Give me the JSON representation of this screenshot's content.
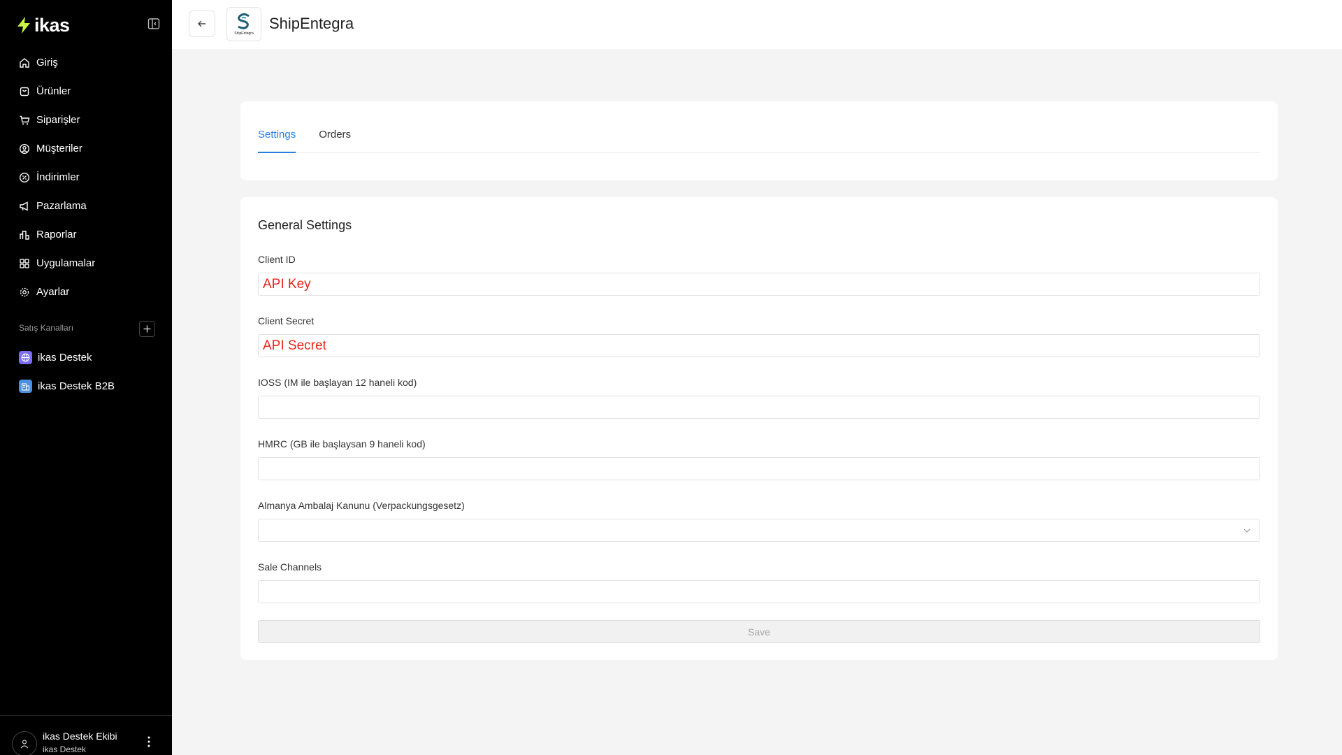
{
  "sidebar": {
    "logo_text": "ikas",
    "nav": [
      {
        "label": "Giriş",
        "icon": "home-icon"
      },
      {
        "label": "Ürünler",
        "icon": "box-icon"
      },
      {
        "label": "Siparişler",
        "icon": "cart-icon"
      },
      {
        "label": "Müşteriler",
        "icon": "user-circle-icon"
      },
      {
        "label": "İndirimler",
        "icon": "discount-icon"
      },
      {
        "label": "Pazarlama",
        "icon": "megaphone-icon"
      },
      {
        "label": "Raporlar",
        "icon": "bar-chart-icon"
      },
      {
        "label": "Uygulamalar",
        "icon": "grid-icon"
      },
      {
        "label": "Ayarlar",
        "icon": "gear-icon"
      }
    ],
    "section_title": "Satış Kanalları",
    "channels": [
      {
        "label": "ikas Destek",
        "icon": "globe-icon",
        "color": "#7b6cf6"
      },
      {
        "label": "ikas Destek B2B",
        "icon": "b2b-store-icon",
        "color": "#4a90e2"
      }
    ],
    "user": {
      "name": "ikas Destek Ekibi",
      "subtitle": "ikas Destek"
    }
  },
  "header": {
    "title": "ShipEntegra",
    "logo_text": "ShipEntegra"
  },
  "tabs": [
    {
      "label": "Settings",
      "active": true
    },
    {
      "label": "Orders",
      "active": false
    }
  ],
  "form": {
    "title": "General Settings",
    "fields": [
      {
        "label": "Client ID",
        "value": "API Key"
      },
      {
        "label": "Client Secret",
        "value": "API Secret"
      },
      {
        "label": "IOSS (IM ile başlayan 12 haneli kod)",
        "value": ""
      },
      {
        "label": "HMRC (GB ile başlaysan 9 haneli kod)",
        "value": ""
      },
      {
        "label": "Almanya Ambalaj Kanunu (Verpackungsgesetz)",
        "value": "",
        "type": "select"
      },
      {
        "label": "Sale Channels",
        "value": ""
      }
    ],
    "save_label": "Save"
  },
  "colors": {
    "accent": "#2a7de1",
    "highlight_text": "#e8251a",
    "sidebar_bg": "#000000"
  }
}
